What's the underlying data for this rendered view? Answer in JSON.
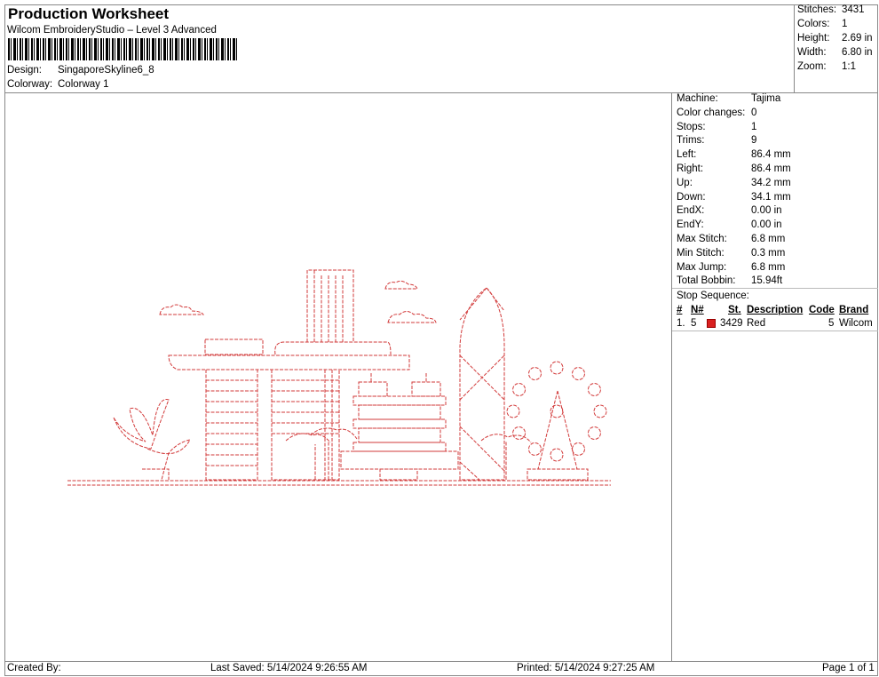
{
  "header": {
    "title": "Production Worksheet",
    "subtitle": "Wilcom EmbroideryStudio – Level 3 Advanced",
    "design_label": "Design:",
    "design_value": "SingaporeSkyline6_8",
    "colorway_label": "Colorway:",
    "colorway_value": "Colorway 1"
  },
  "stats": [
    {
      "label": "Stitches:",
      "value": "3431"
    },
    {
      "label": "Colors:",
      "value": "1"
    },
    {
      "label": "Height:",
      "value": "2.69 in"
    },
    {
      "label": "Width:",
      "value": "6.80 in"
    },
    {
      "label": "Zoom:",
      "value": "1:1"
    }
  ],
  "machine": [
    {
      "label": "Machine:",
      "value": "Tajima"
    },
    {
      "label": "Color changes:",
      "value": "0"
    },
    {
      "label": "Stops:",
      "value": "1"
    },
    {
      "label": "Trims:",
      "value": "9"
    },
    {
      "label": "Left:",
      "value": "86.4 mm"
    },
    {
      "label": "Right:",
      "value": "86.4 mm"
    },
    {
      "label": "Up:",
      "value": "34.2 mm"
    },
    {
      "label": "Down:",
      "value": "34.1 mm"
    },
    {
      "label": "EndX:",
      "value": "0.00 in"
    },
    {
      "label": "EndY:",
      "value": "0.00 in"
    },
    {
      "label": "Max Stitch:",
      "value": "6.8 mm"
    },
    {
      "label": "Min Stitch:",
      "value": "0.3 mm"
    },
    {
      "label": "Max Jump:",
      "value": "6.8 mm"
    },
    {
      "label": "Total Bobbin:",
      "value": "15.94ft"
    }
  ],
  "stop_sequence": {
    "title": "Stop Sequence:",
    "headers": {
      "num": "#",
      "n": "N#",
      "st": "St.",
      "desc": "Description",
      "code": "Code",
      "brand": "Brand"
    },
    "rows": [
      {
        "num": "1.",
        "n": "5",
        "color": "#d92020",
        "st": "3429",
        "desc": "Red",
        "code": "5",
        "brand": "Wilcom"
      }
    ]
  },
  "footer": {
    "created": "Created By:",
    "saved": "Last Saved: 5/14/2024 9:26:55 AM",
    "printed": "Printed: 5/14/2024 9:27:25 AM",
    "page": "Page 1 of 1"
  },
  "design_color": "#d23a3a"
}
